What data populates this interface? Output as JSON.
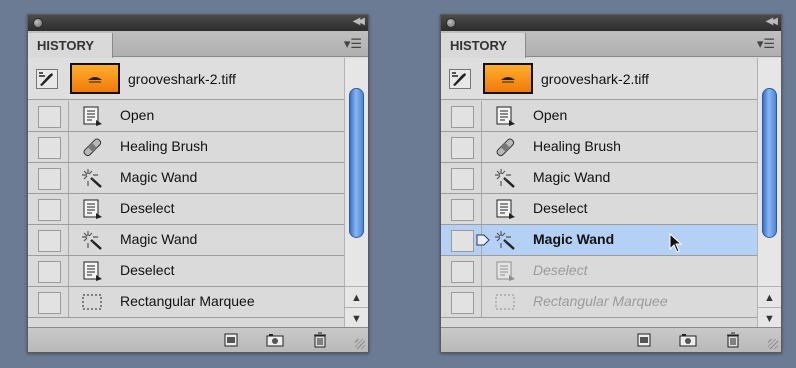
{
  "panels": [
    {
      "tab_label": "HISTORY",
      "snapshot_name": "grooveshark-2.tiff",
      "rows": [
        {
          "label": "Open",
          "icon": "open-document-icon",
          "state": "normal"
        },
        {
          "label": "Healing Brush",
          "icon": "bandage-icon",
          "state": "normal"
        },
        {
          "label": "Magic Wand",
          "icon": "magic-wand-icon",
          "state": "normal"
        },
        {
          "label": "Deselect",
          "icon": "deselect-document-icon",
          "state": "normal"
        },
        {
          "label": "Magic Wand",
          "icon": "magic-wand-icon",
          "state": "normal"
        },
        {
          "label": "Deselect",
          "icon": "deselect-document-icon",
          "state": "normal"
        },
        {
          "label": "Rectangular Marquee",
          "icon": "marquee-icon",
          "state": "normal"
        }
      ]
    },
    {
      "tab_label": "HISTORY",
      "snapshot_name": "grooveshark-2.tiff",
      "rows": [
        {
          "label": "Open",
          "icon": "open-document-icon",
          "state": "normal"
        },
        {
          "label": "Healing Brush",
          "icon": "bandage-icon",
          "state": "normal"
        },
        {
          "label": "Magic Wand",
          "icon": "magic-wand-icon",
          "state": "normal"
        },
        {
          "label": "Deselect",
          "icon": "deselect-document-icon",
          "state": "normal"
        },
        {
          "label": "Magic Wand",
          "icon": "magic-wand-icon",
          "state": "selected"
        },
        {
          "label": "Deselect",
          "icon": "deselect-document-icon",
          "state": "dim"
        },
        {
          "label": "Rectangular Marquee",
          "icon": "marquee-icon",
          "state": "dim"
        }
      ]
    }
  ],
  "colors": {
    "background": "#6b7b93",
    "selected_row": "#b5d0f5",
    "scroll_thumb": "#4d86d8",
    "thumbnail_orange": "#f07a0c"
  },
  "icons": {
    "panel_menu": "panel-menu-icon",
    "collapse": "collapse-arrows-icon",
    "new_document": "new-document-icon",
    "snapshot": "camera-icon",
    "delete": "trash-icon"
  }
}
